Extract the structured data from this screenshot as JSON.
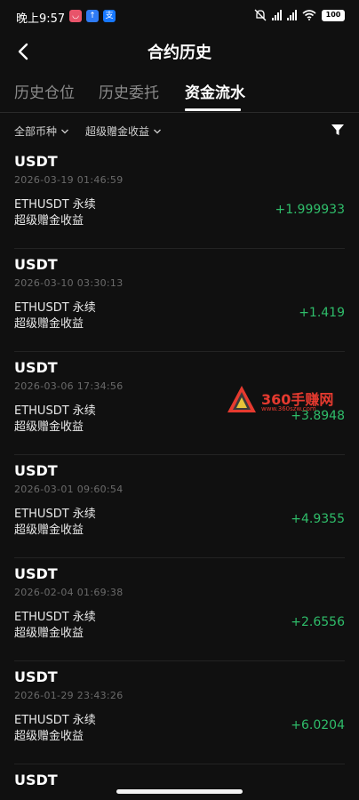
{
  "status_bar": {
    "time": "晚上9:57",
    "battery": "100",
    "app_icons": [
      {
        "name": "app-icon-1",
        "glyph": "◡",
        "color": "#e8546a"
      },
      {
        "name": "app-icon-2",
        "glyph": "↑",
        "color": "#2f7bf5"
      },
      {
        "name": "app-icon-3",
        "glyph": "支",
        "color": "#1677ff"
      }
    ]
  },
  "nav": {
    "title": "合约历史",
    "back_icon": "chevron-left-icon"
  },
  "tabs": [
    {
      "label": "历史仓位",
      "active": false
    },
    {
      "label": "历史委托",
      "active": false
    },
    {
      "label": "资金流水",
      "active": true
    }
  ],
  "filters": {
    "currency": "全部币种",
    "type": "超级赠金收益",
    "filter_icon": "funnel-icon"
  },
  "records": [
    {
      "coin": "USDT",
      "time": "2026-03-19 01:46:59",
      "pair": "ETHUSDT 永续",
      "type": "超级赠金收益",
      "amount": "+1.999933"
    },
    {
      "coin": "USDT",
      "time": "2026-03-10 03:30:13",
      "pair": "ETHUSDT 永续",
      "type": "超级赠金收益",
      "amount": "+1.419"
    },
    {
      "coin": "USDT",
      "time": "2026-03-06 17:34:56",
      "pair": "ETHUSDT 永续",
      "type": "超级赠金收益",
      "amount": "+3.8948"
    },
    {
      "coin": "USDT",
      "time": "2026-03-01 09:60:54",
      "pair": "ETHUSDT 永续",
      "type": "超级赠金收益",
      "amount": "+4.9355"
    },
    {
      "coin": "USDT",
      "time": "2026-02-04 01:69:38",
      "pair": "ETHUSDT 永续",
      "type": "超级赠金收益",
      "amount": "+2.6556"
    },
    {
      "coin": "USDT",
      "time": "2026-01-29 23:43:26",
      "pair": "ETHUSDT 永续",
      "type": "超级赠金收益",
      "amount": "+6.0204"
    }
  ],
  "partial_record": {
    "coin": "USDT"
  },
  "watermark": {
    "text": "360手赚网",
    "sub": "www.360szw.com"
  },
  "colors": {
    "background": "#101010",
    "positive": "#2fbd6a",
    "muted": "#6a6a6a"
  }
}
